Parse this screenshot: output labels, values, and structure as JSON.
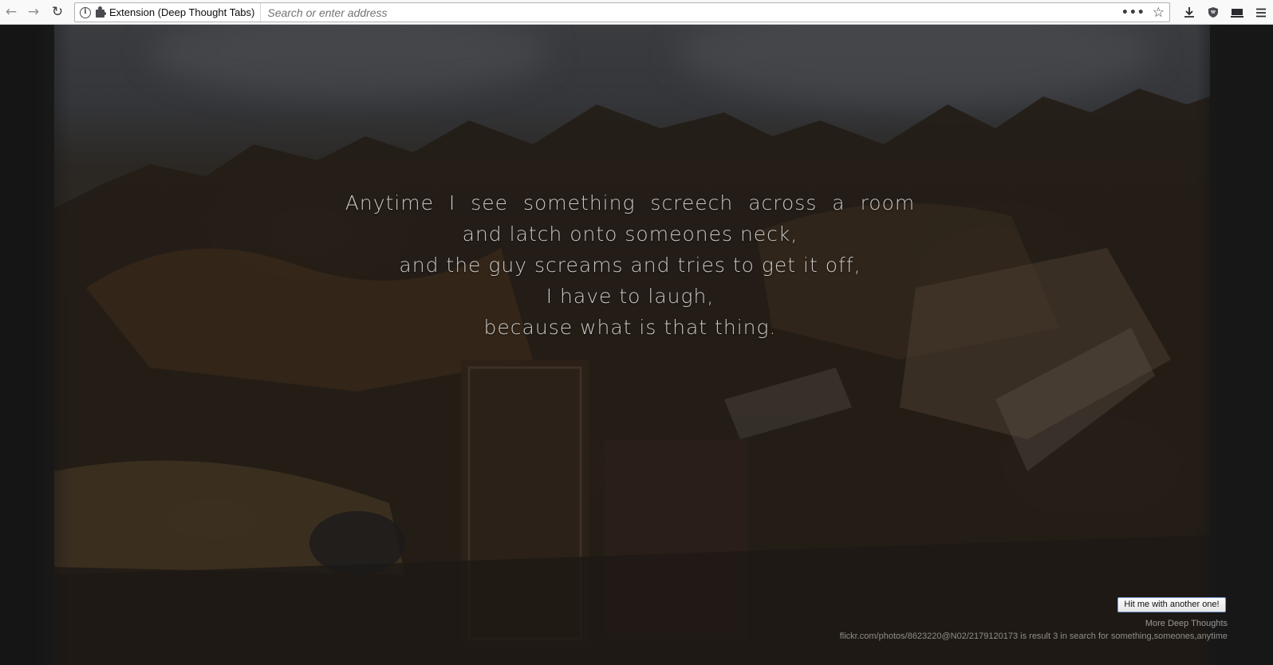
{
  "browser": {
    "back_icon": "back-arrow-icon",
    "forward_icon": "forward-arrow-icon",
    "reload_icon": "reload-icon",
    "identity_label": "Extension (Deep Thought Tabs)",
    "url_placeholder": "Search or enter address",
    "url_value": "",
    "toolbar_icons": [
      "page-actions-icon",
      "bookmark-star-icon",
      "downloads-icon",
      "shield-icon",
      "library-icon",
      "menu-icon"
    ]
  },
  "thought": {
    "lines": [
      "Anytime I see something screech across a room",
      "and latch onto someones neck,",
      "and the guy screams and tries to get it off,",
      "I have to laugh,",
      "because what is that thing."
    ]
  },
  "footer": {
    "button_label": "Hit me with another one!",
    "more_link": "More Deep Thoughts",
    "source_text": "flickr.com/photos/8623220@N02/2179120173 is result 3 in search for something,someones,anytime"
  },
  "colors": {
    "text": "#c9c7c4",
    "toolbar_bg": "#f9f9fa",
    "page_bg": "#1b1b1a"
  }
}
